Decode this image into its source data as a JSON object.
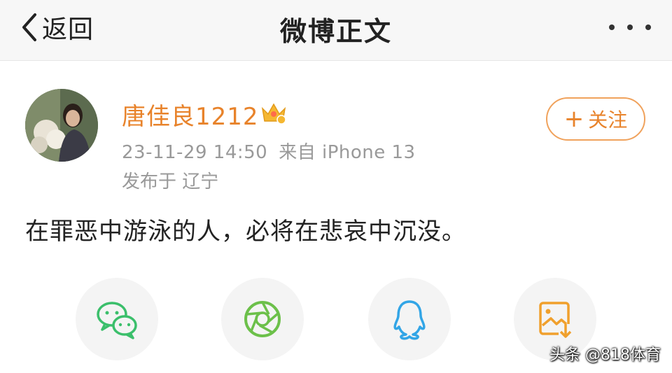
{
  "header": {
    "back_label": "返回",
    "title": "微博正文"
  },
  "post": {
    "username": "唐佳良1212",
    "vip_badge_icon": "crown-icon",
    "timestamp": "23-11-29 14:50",
    "source": "来自 iPhone 13",
    "location": "发布于 辽宁",
    "follow_label": "关注",
    "text": "在罪恶中游泳的人，必将在悲哀中沉没。"
  },
  "share": {
    "items": [
      {
        "name": "wechat",
        "icon": "wechat-icon",
        "color": "#3bbf6b"
      },
      {
        "name": "moments",
        "icon": "moments-icon",
        "color": "#6cc04a"
      },
      {
        "name": "qq",
        "icon": "qq-icon",
        "color": "#32a5e6"
      },
      {
        "name": "save-image",
        "icon": "save-image-icon",
        "color": "#f0a02d"
      }
    ]
  },
  "watermark": "头条 @818体育",
  "colors": {
    "accent": "#e8832b",
    "meta_text": "#999999"
  }
}
